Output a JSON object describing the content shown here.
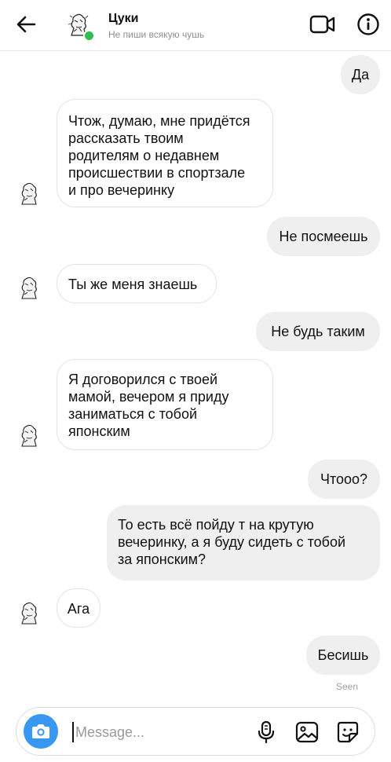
{
  "header": {
    "contact_name": "Цуки",
    "status": "Не пиши всякую чушь",
    "icons": {
      "back": "arrow-left-icon",
      "video": "video-camera-icon",
      "info": "info-circle-icon"
    },
    "online_color": "#2fbf50"
  },
  "messages": [
    {
      "from": "me",
      "text": "Да"
    },
    {
      "from": "them",
      "text": "Чтож, думаю, мне придётся\nрассказать твоим\nродителям о недавнем\nпроисшествии в спортзале\nи про вечеринку"
    },
    {
      "from": "me",
      "text": "Не посмеешь"
    },
    {
      "from": "them",
      "text": "Ты же меня знаешь"
    },
    {
      "from": "me",
      "text": "Не будь таким"
    },
    {
      "from": "them",
      "text": "Я договорился с твоей\nмамой, вечером я приду\nзаниматься с тобой\nяпонским"
    },
    {
      "from": "me",
      "text": "Чтооо?"
    },
    {
      "from": "me",
      "text": "То есть всё пойду т на крутую\nвечеринку, а я буду сидеть с тобой\nза японским?"
    },
    {
      "from": "them",
      "text": "Ага"
    },
    {
      "from": "me",
      "text": "Бесишь"
    }
  ],
  "seen_label": "Seen",
  "composer": {
    "placeholder": "Message...",
    "camera_color": "#3897f0",
    "icons": {
      "camera": "camera-icon",
      "mic": "microphone-icon",
      "gallery": "image-gallery-icon",
      "sticker": "sticker-icon"
    }
  }
}
